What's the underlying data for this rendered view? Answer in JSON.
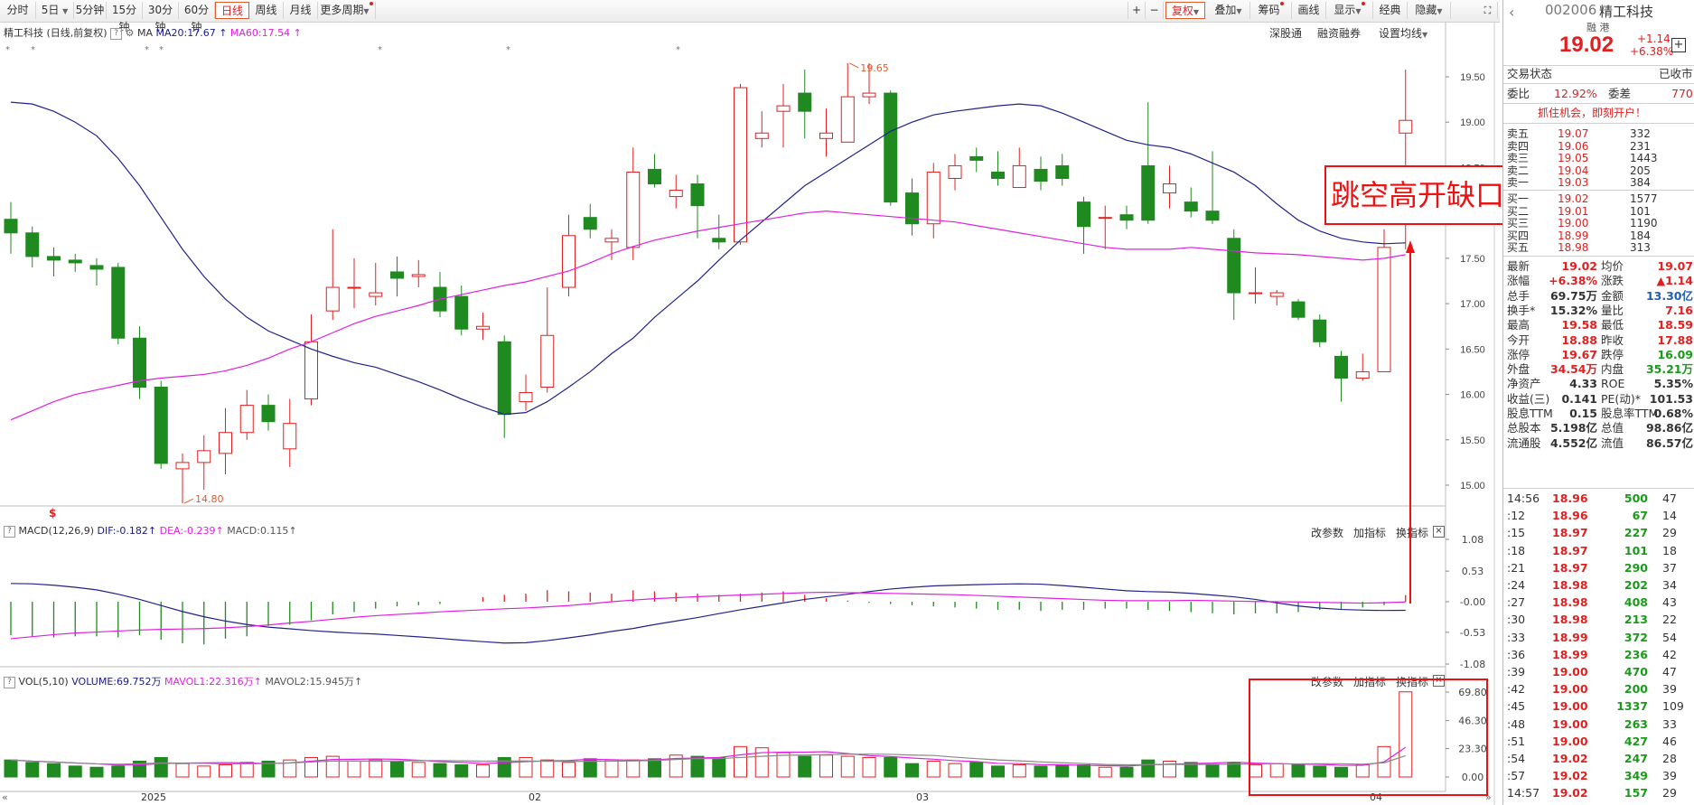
{
  "toolbar": {
    "periods": [
      "分时",
      "5日",
      "5分钟",
      "15分钟",
      "30分钟",
      "60分钟",
      "日线",
      "周线",
      "月线",
      "更多周期"
    ],
    "active_period": "日线",
    "right_items": [
      "+",
      "−",
      "复权",
      "叠加",
      "筹码",
      "画线",
      "显示",
      "经典",
      "隐藏"
    ]
  },
  "kline_header": {
    "stock": "精工科技",
    "mode": "(日线,前复权)",
    "ma_label": "MA",
    "ma20": "MA20:17.67",
    "ma60": "MA60:17.54",
    "right_links": [
      "深股通",
      "融资融券",
      "设置均线"
    ]
  },
  "macd_header": {
    "name": "MACD(12,26,9)",
    "dif": "DIF:-0.182",
    "dea": "DEA:-0.239",
    "macd": "MACD:0.115",
    "links": [
      "改参数",
      "加指标",
      "换指标"
    ]
  },
  "vol_header": {
    "name": "VOL(5,10)",
    "volume": "VOLUME:69.752万",
    "mavol1": "MAVOL1:22.316万",
    "mavol2": "MAVOL2:15.945万",
    "links": [
      "改参数",
      "加指标",
      "换指标"
    ]
  },
  "annotation": "跳空高开缺口",
  "x_axis_labels": [
    "2025",
    "02",
    "03",
    "04"
  ],
  "price_axis": [
    "19.50",
    "19.00",
    "18.50",
    "18.00",
    "17.50",
    "17.00",
    "16.50",
    "16.00",
    "15.50",
    "15.00"
  ],
  "macd_axis": [
    "1.08",
    "0.53",
    "-0.00",
    "-0.53",
    "-1.08"
  ],
  "vol_axis": [
    "69.80",
    "46.30",
    "23.30",
    "0.00"
  ],
  "chart_data": {
    "type": "candlestick",
    "high_label": "19.65",
    "low_label": "14.80",
    "candles": [
      [
        17.93,
        17.78,
        18.12,
        17.55
      ],
      [
        17.78,
        17.52,
        17.85,
        17.4
      ],
      [
        17.52,
        17.48,
        17.62,
        17.3
      ],
      [
        17.48,
        17.45,
        17.55,
        17.35
      ],
      [
        17.42,
        17.38,
        17.5,
        17.2
      ],
      [
        17.4,
        16.62,
        17.45,
        16.55
      ],
      [
        16.62,
        16.08,
        16.75,
        15.95
      ],
      [
        16.08,
        15.24,
        16.15,
        15.18
      ],
      [
        15.18,
        15.25,
        15.35,
        14.8
      ],
      [
        15.25,
        15.38,
        15.55,
        14.95
      ],
      [
        15.35,
        15.58,
        15.85,
        15.12
      ],
      [
        15.58,
        15.88,
        16.05,
        15.5
      ],
      [
        15.88,
        15.7,
        16.0,
        15.6
      ],
      [
        15.4,
        15.68,
        15.95,
        15.2
      ],
      [
        15.95,
        16.58,
        16.88,
        15.88
      ],
      [
        16.92,
        17.18,
        17.82,
        16.82
      ],
      [
        17.18,
        17.18,
        17.5,
        16.95
      ],
      [
        17.08,
        17.12,
        17.45,
        16.98
      ],
      [
        17.35,
        17.28,
        17.52,
        17.08
      ],
      [
        17.3,
        17.32,
        17.48,
        17.18
      ],
      [
        17.18,
        16.92,
        17.35,
        16.85
      ],
      [
        17.08,
        16.72,
        17.2,
        16.65
      ],
      [
        16.72,
        16.75,
        16.9,
        16.6
      ],
      [
        16.58,
        15.78,
        16.65,
        15.52
      ],
      [
        15.92,
        16.02,
        16.22,
        15.82
      ],
      [
        16.08,
        16.65,
        17.18,
        16.02
      ],
      [
        17.18,
        17.75,
        17.98,
        17.08
      ],
      [
        17.95,
        17.82,
        18.1,
        17.72
      ],
      [
        17.68,
        17.72,
        17.82,
        17.48
      ],
      [
        17.62,
        18.45,
        18.72,
        17.48
      ],
      [
        18.48,
        18.32,
        18.65,
        18.28
      ],
      [
        18.18,
        18.25,
        18.42,
        18.05
      ],
      [
        18.32,
        18.08,
        18.42,
        17.72
      ],
      [
        17.72,
        17.68,
        17.98,
        17.6
      ],
      [
        17.68,
        19.38,
        19.42,
        17.65
      ],
      [
        18.82,
        18.88,
        19.12,
        18.72
      ],
      [
        19.12,
        19.18,
        19.42,
        18.72
      ],
      [
        19.32,
        19.12,
        19.58,
        18.82
      ],
      [
        18.82,
        18.88,
        19.15,
        18.62
      ],
      [
        18.78,
        19.28,
        19.65,
        18.78
      ],
      [
        19.28,
        19.32,
        19.65,
        19.2
      ],
      [
        19.32,
        18.12,
        19.35,
        18.08
      ],
      [
        18.22,
        17.88,
        18.38,
        17.75
      ],
      [
        17.88,
        18.45,
        18.55,
        17.72
      ],
      [
        18.38,
        18.52,
        18.65,
        18.25
      ],
      [
        18.62,
        18.58,
        18.72,
        18.45
      ],
      [
        18.45,
        18.38,
        18.68,
        18.3
      ],
      [
        18.28,
        18.52,
        18.72,
        18.28
      ],
      [
        18.48,
        18.35,
        18.62,
        18.25
      ],
      [
        18.52,
        18.38,
        18.65,
        18.3
      ],
      [
        18.12,
        17.85,
        18.18,
        17.55
      ],
      [
        17.95,
        17.95,
        18.08,
        17.6
      ],
      [
        17.98,
        17.92,
        18.08,
        17.82
      ],
      [
        18.52,
        17.92,
        19.22,
        17.88
      ],
      [
        18.22,
        18.32,
        18.52,
        18.05
      ],
      [
        18.12,
        18.02,
        18.28,
        17.95
      ],
      [
        18.02,
        17.92,
        18.68,
        17.88
      ],
      [
        17.72,
        17.12,
        17.82,
        16.82
      ],
      [
        17.12,
        17.12,
        17.4,
        17.0
      ],
      [
        17.08,
        17.12,
        17.15,
        16.98
      ],
      [
        17.02,
        16.85,
        17.05,
        16.82
      ],
      [
        16.82,
        16.58,
        16.88,
        16.52
      ],
      [
        16.42,
        16.18,
        16.48,
        15.92
      ],
      [
        16.18,
        16.25,
        16.45,
        16.15
      ],
      [
        16.25,
        17.62,
        17.82,
        16.25
      ],
      [
        18.88,
        19.02,
        19.58,
        17.6
      ]
    ],
    "macd_bars": [
      -0.58,
      -0.6,
      -0.62,
      -0.6,
      -0.6,
      -0.62,
      -0.58,
      -0.66,
      -0.72,
      -0.74,
      -0.64,
      -0.6,
      -0.42,
      -0.4,
      -0.32,
      -0.22,
      -0.18,
      -0.12,
      -0.08,
      -0.06,
      -0.04,
      0.0,
      0.08,
      0.12,
      0.14,
      0.2,
      0.18,
      0.16,
      0.14,
      0.2,
      0.18,
      0.16,
      0.14,
      0.12,
      0.14,
      0.16,
      0.18,
      0.12,
      0.06,
      0.02,
      -0.02,
      -0.04,
      -0.06,
      -0.08,
      -0.1,
      -0.12,
      -0.14,
      -0.14,
      -0.16,
      -0.14,
      -0.14,
      -0.12,
      -0.12,
      -0.14,
      -0.16,
      -0.18,
      -0.2,
      -0.22,
      -0.2,
      -0.2,
      -0.18,
      -0.14,
      -0.14,
      -0.1,
      -0.06,
      0.115
    ],
    "vol_bars": [
      14,
      12,
      11,
      9,
      8,
      9,
      13,
      16,
      11,
      9,
      10,
      12,
      13,
      14,
      16,
      17,
      13,
      14,
      13,
      12,
      11,
      10,
      10,
      16,
      16,
      14,
      12,
      15,
      14,
      14,
      15,
      18,
      17,
      16,
      25,
      24,
      20,
      17,
      18,
      17,
      16,
      16,
      11,
      13,
      11,
      12,
      9,
      10,
      9,
      10,
      10,
      8,
      8,
      14,
      13,
      12,
      10,
      12,
      10,
      11,
      10,
      9,
      8,
      10,
      25,
      70
    ],
    "ma20_line": [
      19.22,
      19.2,
      19.12,
      19.0,
      18.85,
      18.6,
      18.3,
      17.95,
      17.6,
      17.3,
      17.05,
      16.85,
      16.7,
      16.6,
      16.5,
      16.42,
      16.35,
      16.3,
      16.22,
      16.14,
      16.05,
      15.95,
      15.86,
      15.78,
      15.8,
      15.92,
      16.08,
      16.25,
      16.45,
      16.62,
      16.85,
      17.05,
      17.25,
      17.48,
      17.7,
      17.9,
      18.1,
      18.3,
      18.45,
      18.6,
      18.75,
      18.9,
      19.0,
      19.08,
      19.12,
      19.15,
      19.18,
      19.2,
      19.18,
      19.1,
      19.0,
      18.9,
      18.8,
      18.75,
      18.72,
      18.65,
      18.55,
      18.45,
      18.3,
      18.1,
      17.92,
      17.8,
      17.72,
      17.68,
      17.66,
      17.67
    ],
    "ma60_line": [
      15.72,
      15.82,
      15.92,
      16.0,
      16.05,
      16.1,
      16.15,
      16.18,
      16.2,
      16.22,
      16.26,
      16.32,
      16.4,
      16.5,
      16.58,
      16.68,
      16.78,
      16.86,
      16.92,
      16.98,
      17.05,
      17.1,
      17.15,
      17.2,
      17.24,
      17.3,
      17.36,
      17.45,
      17.55,
      17.63,
      17.7,
      17.75,
      17.8,
      17.84,
      17.88,
      17.92,
      17.96,
      18.0,
      18.02,
      18.0,
      17.98,
      17.96,
      17.94,
      17.92,
      17.9,
      17.86,
      17.82,
      17.78,
      17.74,
      17.7,
      17.66,
      17.62,
      17.6,
      17.6,
      17.6,
      17.62,
      17.6,
      17.58,
      17.56,
      17.55,
      17.54,
      17.52,
      17.5,
      17.48,
      17.5,
      17.54
    ]
  },
  "right_panel": {
    "code": "002006",
    "name": "精工科技",
    "tags": "融 港",
    "price": "19.02",
    "change": "+1.14",
    "pct": "+6.38%",
    "trade_status_label": "交易状态",
    "trade_status": "已收市",
    "weibi_label": "委比",
    "weibi": "12.92%",
    "weicha_label": "委差",
    "weicha": "770",
    "promo": "抓住机会，即刻开户！",
    "sell": [
      [
        "卖五",
        "19.07",
        "332"
      ],
      [
        "卖四",
        "19.06",
        "231"
      ],
      [
        "卖三",
        "19.05",
        "1443"
      ],
      [
        "卖二",
        "19.04",
        "205"
      ],
      [
        "卖一",
        "19.03",
        "384"
      ]
    ],
    "buy": [
      [
        "买一",
        "19.02",
        "1577"
      ],
      [
        "买二",
        "19.01",
        "101"
      ],
      [
        "买三",
        "19.00",
        "1190"
      ],
      [
        "买四",
        "18.99",
        "184"
      ],
      [
        "买五",
        "18.98",
        "313"
      ]
    ],
    "stats": [
      [
        "最新",
        "19.02",
        "均价",
        "19.07"
      ],
      [
        "涨幅",
        "+6.38%",
        "涨跌",
        "▲1.14"
      ],
      [
        "总手",
        "69.75万",
        "金额",
        "13.30亿"
      ],
      [
        "换手*",
        "15.32%",
        "量比",
        "7.16"
      ],
      [
        "最高",
        "19.58",
        "最低",
        "18.59"
      ],
      [
        "今开",
        "18.88",
        "昨收",
        "17.88"
      ],
      [
        "涨停",
        "19.67",
        "跌停",
        "16.09"
      ],
      [
        "外盘",
        "34.54万",
        "内盘",
        "35.21万"
      ],
      [
        "净资产",
        "4.33",
        "ROE",
        "5.35%"
      ],
      [
        "收益(三)",
        "0.141",
        "PE(动)*",
        "101.53"
      ],
      [
        "股息TTM",
        "0.15",
        "股息率TTM",
        "0.68%"
      ],
      [
        "总股本",
        "5.198亿",
        "总值",
        "98.86亿"
      ],
      [
        "流通股",
        "4.552亿",
        "流值",
        "86.57亿"
      ]
    ],
    "ticks": [
      [
        "14:56",
        "18.96",
        "500",
        "47"
      ],
      [
        ":12",
        "18.96",
        "67",
        "14"
      ],
      [
        ":15",
        "18.97",
        "227",
        "29"
      ],
      [
        ":18",
        "18.97",
        "101",
        "18"
      ],
      [
        ":21",
        "18.97",
        "290",
        "37"
      ],
      [
        ":24",
        "18.98",
        "202",
        "34"
      ],
      [
        ":27",
        "18.98",
        "408",
        "43"
      ],
      [
        ":30",
        "18.98",
        "213",
        "22"
      ],
      [
        ":33",
        "18.99",
        "372",
        "54"
      ],
      [
        ":36",
        "18.99",
        "236",
        "42"
      ],
      [
        ":39",
        "19.00",
        "470",
        "47"
      ],
      [
        ":42",
        "19.00",
        "200",
        "39"
      ],
      [
        ":45",
        "19.00",
        "1337",
        "109"
      ],
      [
        ":48",
        "19.00",
        "263",
        "33"
      ],
      [
        ":51",
        "19.00",
        "427",
        "46"
      ],
      [
        ":54",
        "19.02",
        "247",
        "28"
      ],
      [
        ":57",
        "19.02",
        "349",
        "39"
      ],
      [
        "14:57",
        "19.02",
        "157",
        "29"
      ]
    ]
  }
}
